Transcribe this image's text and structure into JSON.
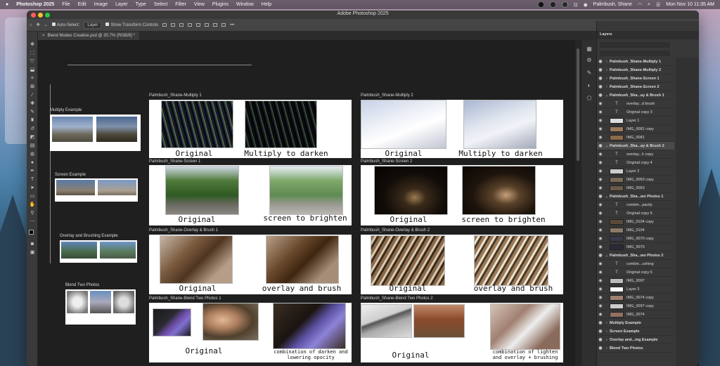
{
  "menubar": {
    "app_name": "Photoshop 2025",
    "items": [
      "File",
      "Edit",
      "Image",
      "Layer",
      "Type",
      "Select",
      "Filter",
      "View",
      "Plugins",
      "Window",
      "Help"
    ],
    "user": "Palmbush, Shane",
    "datetime": "Mon Nov 10  11:35 AM"
  },
  "window": {
    "title": "Adobe Photoshop 2025"
  },
  "options_bar": {
    "auto_select_label": "Auto-Select:",
    "auto_select_value": "Layer",
    "show_transform_label": "Show Transform Controls"
  },
  "document_tab": {
    "label": "Blend Modes Creative.psd @ 30.7% (RGB/8) *",
    "close": "×"
  },
  "canvas": {
    "left_labels": {
      "multiply": "Multiply Example",
      "screen": "Screen Example",
      "overlay": "Overlay and Brushing Example",
      "blend": "Blend Two Photos"
    },
    "artboards": [
      {
        "title": "Palmbush_Shane-Multiply 1",
        "captions": [
          "Original",
          "Multiply to darken"
        ]
      },
      {
        "title": "Palmbush_Shane-Multiply 2",
        "captions": [
          "Original",
          "Multiply to darken"
        ]
      },
      {
        "title": "Palmbush_Shane-Screen 1",
        "captions": [
          "Original",
          "screen to brighten"
        ]
      },
      {
        "title": "Palmbush_Shane-Screen 2",
        "captions": [
          "Original",
          "screen to brighten"
        ]
      },
      {
        "title": "Palmbush_Shane-Overlay & Brush 1",
        "captions": [
          "Original",
          "overlay and brush"
        ]
      },
      {
        "title": "Palmbush_Shane-Overlay & Brush 2",
        "captions": [
          "Original",
          "overlay and brush"
        ]
      },
      {
        "title": "Palmbush_Shane-Blend Two Photos 1",
        "captions": [
          "Original",
          "combination of darken and\nlowering opocity"
        ]
      },
      {
        "title": "Palmbush_Shane-Blend Two Photos 2",
        "captions": [
          "Original",
          "combination of lighten\nand overlay + brushing"
        ]
      }
    ]
  },
  "layers_panel": {
    "tab": "Layers",
    "rows": [
      {
        "name": "Palmbush_Shane-Multiply 1",
        "type": "group"
      },
      {
        "name": "Palmbush_Shane-Multiply 2",
        "type": "group"
      },
      {
        "name": "Palmbush_Shane-Screen 1",
        "type": "group"
      },
      {
        "name": "Palmbush_Shane-Screen 2",
        "type": "group"
      },
      {
        "name": "Palmbush_Sha...ay & Brush 1",
        "type": "group-open"
      },
      {
        "name": "overlay...d brush",
        "type": "text"
      },
      {
        "name": "Original copy 3",
        "type": "text"
      },
      {
        "name": "Layer 1",
        "type": "pixel"
      },
      {
        "name": "IMG_0081 copy",
        "type": "pixel"
      },
      {
        "name": "IMG_0081",
        "type": "pixel"
      },
      {
        "name": "Palmbush_Sha...ay & Brush 2",
        "type": "group-open"
      },
      {
        "name": "overlay...h copy",
        "type": "text"
      },
      {
        "name": "Original copy 4",
        "type": "text"
      },
      {
        "name": "Layer 2",
        "type": "pixel"
      },
      {
        "name": "IMG_0063 copy",
        "type": "pixel"
      },
      {
        "name": "IMG_0063",
        "type": "pixel"
      },
      {
        "name": "Palmbush_Sha...wo Photos 1",
        "type": "group-open"
      },
      {
        "name": "combin...pacity",
        "type": "text"
      },
      {
        "name": "Original copy 5",
        "type": "text"
      },
      {
        "name": "IMG_0104 copy",
        "type": "pixel"
      },
      {
        "name": "IMG_0104",
        "type": "pixel"
      },
      {
        "name": "IMG_0070 copy",
        "type": "pixel"
      },
      {
        "name": "IMG_0070",
        "type": "pixel"
      },
      {
        "name": "Palmbush_Sha...wo Photos 2",
        "type": "group-open"
      },
      {
        "name": "combin...ushing",
        "type": "text"
      },
      {
        "name": "Original copy 6",
        "type": "text"
      },
      {
        "name": "IMG_0097",
        "type": "pixel"
      },
      {
        "name": "Layer 3",
        "type": "pixel"
      },
      {
        "name": "IMG_0074 copy",
        "type": "pixel"
      },
      {
        "name": "IMG_0097 copy",
        "type": "pixel"
      },
      {
        "name": "IMG_0074",
        "type": "pixel"
      },
      {
        "name": "Multiply Example",
        "type": "group"
      },
      {
        "name": "Screen Example",
        "type": "group"
      },
      {
        "name": "Overlay and...ing Example",
        "type": "group"
      },
      {
        "name": "Blend Two Photos",
        "type": "group"
      }
    ]
  }
}
